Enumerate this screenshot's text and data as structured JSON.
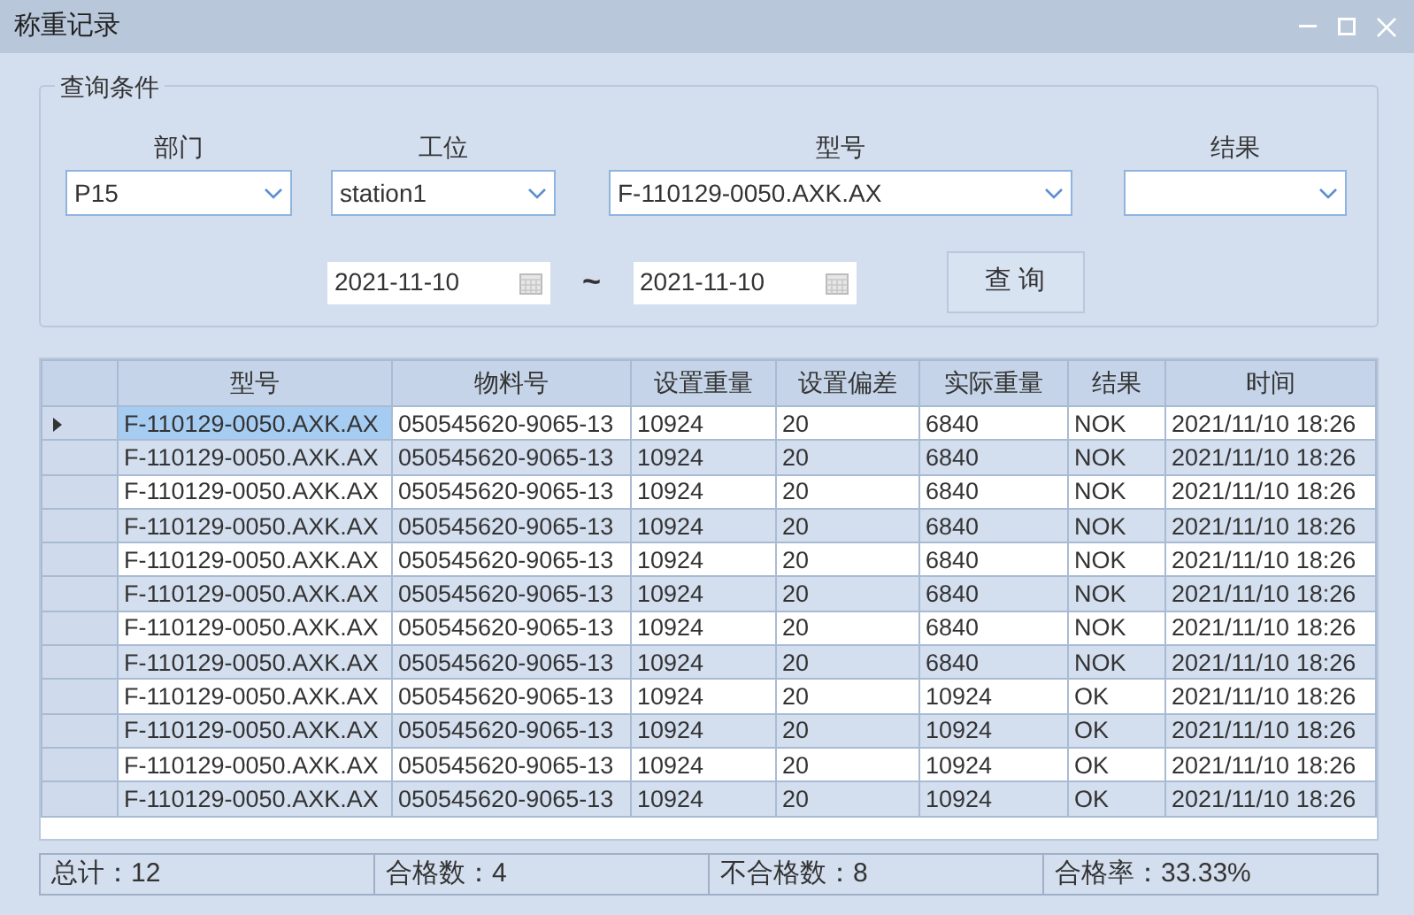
{
  "window": {
    "title": "称重记录"
  },
  "query": {
    "title": "查询条件",
    "filters": [
      {
        "label": "部门",
        "value": "P15"
      },
      {
        "label": "工位",
        "value": "station1"
      },
      {
        "label": "型号",
        "value": "F-110129-0050.AXK.AX"
      },
      {
        "label": "结果"
      }
    ],
    "date_from": "2021-11-10",
    "date_separator": "~",
    "date_to": "2021-11-10",
    "button": "查 询"
  },
  "table": {
    "columns": [
      "型号",
      "物料号",
      "设置重量",
      "设置偏差",
      "实际重量",
      "结果",
      "时间"
    ],
    "rows": [
      {
        "selected": true,
        "cells": [
          "F-110129-0050.AXK.AX",
          "050545620-9065-13",
          "10924",
          "20",
          "6840",
          "NOK",
          "2021/11/10 18:26"
        ]
      },
      {
        "selected": false,
        "cells": [
          "F-110129-0050.AXK.AX",
          "050545620-9065-13",
          "10924",
          "20",
          "6840",
          "NOK",
          "2021/11/10 18:26"
        ]
      },
      {
        "selected": false,
        "cells": [
          "F-110129-0050.AXK.AX",
          "050545620-9065-13",
          "10924",
          "20",
          "6840",
          "NOK",
          "2021/11/10 18:26"
        ]
      },
      {
        "selected": false,
        "cells": [
          "F-110129-0050.AXK.AX",
          "050545620-9065-13",
          "10924",
          "20",
          "6840",
          "NOK",
          "2021/11/10 18:26"
        ]
      },
      {
        "selected": false,
        "cells": [
          "F-110129-0050.AXK.AX",
          "050545620-9065-13",
          "10924",
          "20",
          "6840",
          "NOK",
          "2021/11/10 18:26"
        ]
      },
      {
        "selected": false,
        "cells": [
          "F-110129-0050.AXK.AX",
          "050545620-9065-13",
          "10924",
          "20",
          "6840",
          "NOK",
          "2021/11/10 18:26"
        ]
      },
      {
        "selected": false,
        "cells": [
          "F-110129-0050.AXK.AX",
          "050545620-9065-13",
          "10924",
          "20",
          "6840",
          "NOK",
          "2021/11/10 18:26"
        ]
      },
      {
        "selected": false,
        "cells": [
          "F-110129-0050.AXK.AX",
          "050545620-9065-13",
          "10924",
          "20",
          "6840",
          "NOK",
          "2021/11/10 18:26"
        ]
      },
      {
        "selected": false,
        "cells": [
          "F-110129-0050.AXK.AX",
          "050545620-9065-13",
          "10924",
          "20",
          "10924",
          "OK",
          "2021/11/10 18:26"
        ]
      },
      {
        "selected": false,
        "cells": [
          "F-110129-0050.AXK.AX",
          "050545620-9065-13",
          "10924",
          "20",
          "10924",
          "OK",
          "2021/11/10 18:26"
        ]
      },
      {
        "selected": false,
        "cells": [
          "F-110129-0050.AXK.AX",
          "050545620-9065-13",
          "10924",
          "20",
          "10924",
          "OK",
          "2021/11/10 18:26"
        ]
      },
      {
        "selected": false,
        "cells": [
          "F-110129-0050.AXK.AX",
          "050545620-9065-13",
          "10924",
          "20",
          "10924",
          "OK",
          "2021/11/10 18:26"
        ]
      }
    ]
  },
  "status_bar": [
    "总计：12",
    "合格数：4",
    "不合格数：8",
    "合格率：33.33%"
  ]
}
